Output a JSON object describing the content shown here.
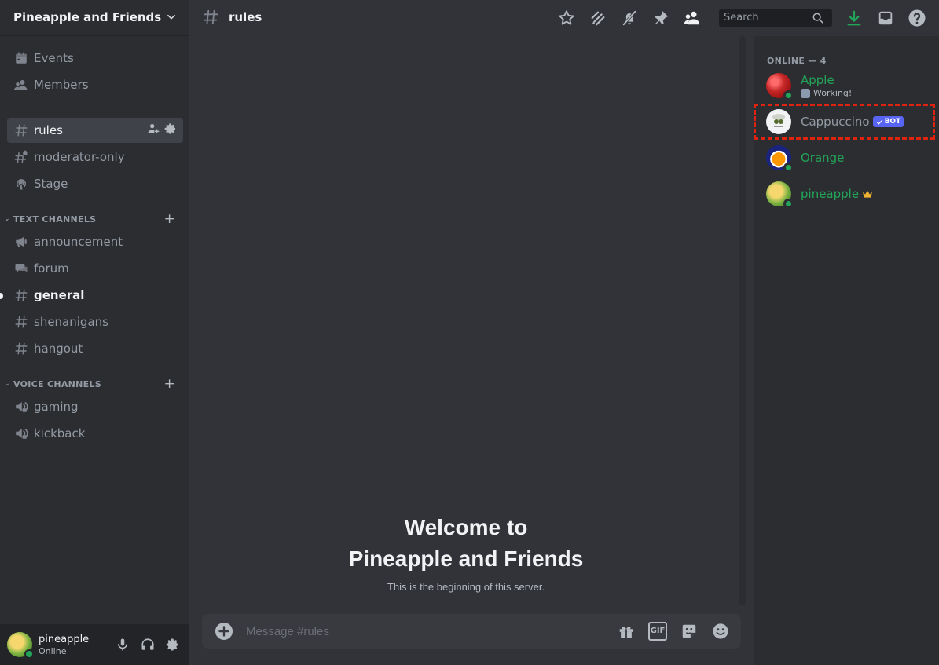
{
  "server": {
    "name": "Pineapple and Friends"
  },
  "nav": [
    {
      "id": "events",
      "label": "Events",
      "icon": "calendar-icon"
    },
    {
      "id": "members",
      "label": "Members",
      "icon": "members-icon"
    }
  ],
  "channels_top": [
    {
      "label": "rules",
      "icon": "hash-icon",
      "active": true
    },
    {
      "label": "moderator-only",
      "icon": "locked-hash-icon"
    },
    {
      "label": "Stage",
      "icon": "stage-icon"
    }
  ],
  "categories": [
    {
      "label": "TEXT CHANNELS",
      "channels": [
        {
          "label": "announcement",
          "icon": "megaphone-icon"
        },
        {
          "label": "forum",
          "icon": "forum-icon"
        },
        {
          "label": "general",
          "icon": "hash-icon",
          "unread": true
        },
        {
          "label": "shenanigans",
          "icon": "hash-icon"
        },
        {
          "label": "hangout",
          "icon": "hash-icon"
        }
      ]
    },
    {
      "label": "VOICE CHANNELS",
      "channels": [
        {
          "label": "gaming",
          "icon": "voice-icon"
        },
        {
          "label": "kickback",
          "icon": "voice-icon"
        }
      ]
    }
  ],
  "user": {
    "name": "pineapple",
    "status": "Online"
  },
  "topbar": {
    "channel": "rules",
    "search_placeholder": "Search"
  },
  "welcome": {
    "line1": "Welcome to",
    "line2": "Pineapple and Friends",
    "sub": "This is the beginning of this server."
  },
  "composer": {
    "placeholder": "Message #rules"
  },
  "members": {
    "group_label": "ONLINE — 4",
    "list": [
      {
        "name": "Apple",
        "activity": "Working!",
        "online": true
      },
      {
        "name": "Cappuccino",
        "tag": "BOT",
        "online": false
      },
      {
        "name": "Orange",
        "online": true
      },
      {
        "name": "pineapple",
        "crown": true,
        "online": true
      }
    ]
  },
  "colors": {
    "accent": "#5865f2",
    "online": "#23a559",
    "highlight": "#e0230f",
    "download": "#23a559"
  }
}
